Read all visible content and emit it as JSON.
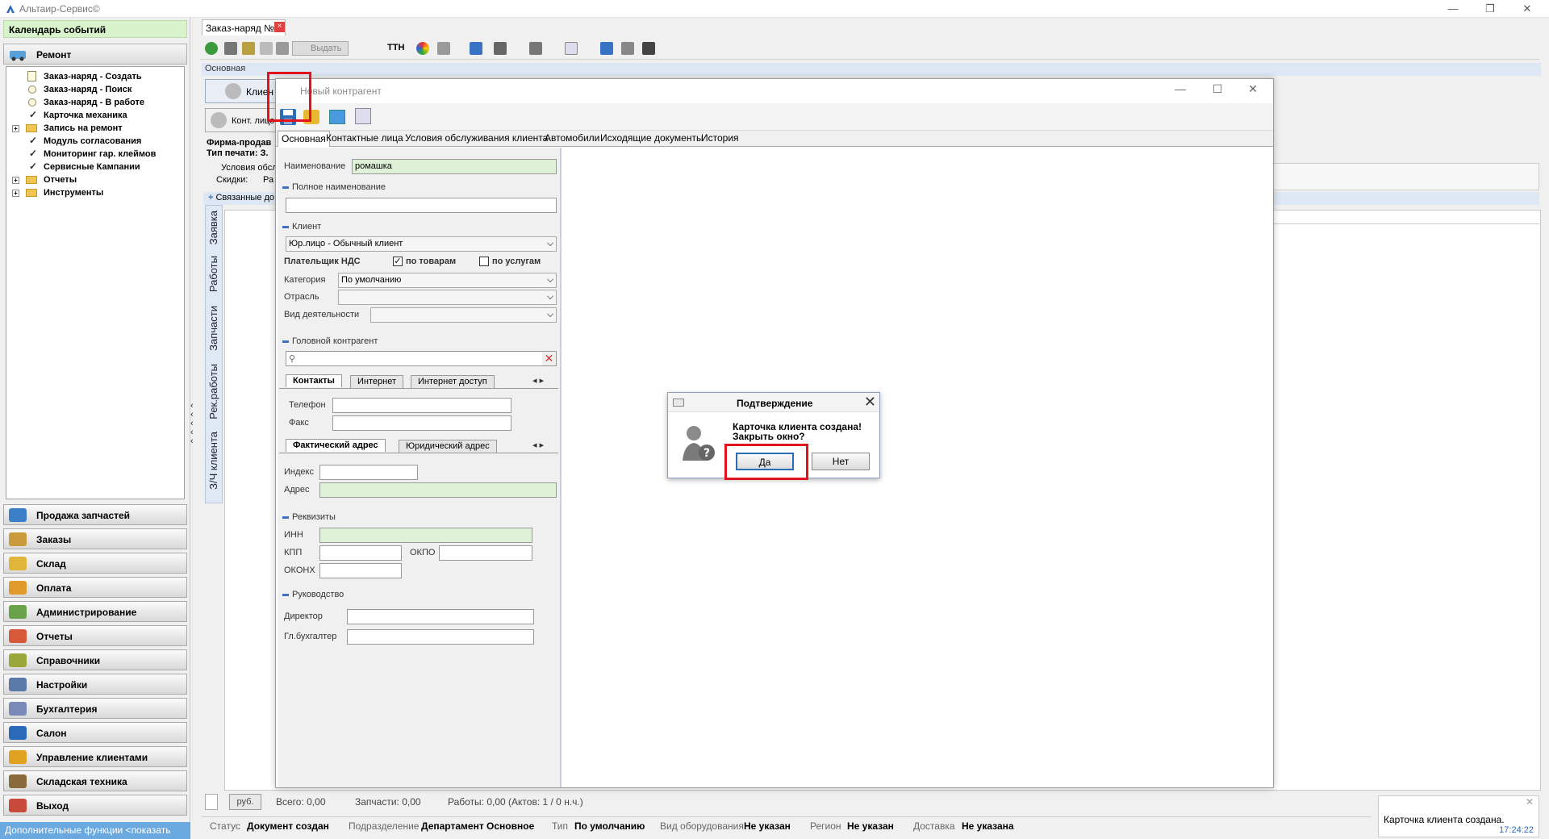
{
  "app": {
    "title": "Альтаир-Сервис©"
  },
  "left": {
    "calendar": "Календарь событий",
    "section": "Ремонт",
    "tree": [
      {
        "label": "Заказ-наряд - Создать",
        "kind": "doc"
      },
      {
        "label": "Заказ-наряд - Поиск",
        "kind": "circle"
      },
      {
        "label": "Заказ-наряд - В работе",
        "kind": "circle"
      },
      {
        "label": "Карточка механика",
        "kind": "check"
      },
      {
        "label": "Запись на ремонт",
        "kind": "folder"
      },
      {
        "label": "Модуль согласования",
        "kind": "check"
      },
      {
        "label": "Мониторинг гар. клеймов",
        "kind": "check"
      },
      {
        "label": "Сервисные Кампании",
        "kind": "check"
      },
      {
        "label": "Отчеты",
        "kind": "folder"
      },
      {
        "label": "Инструменты",
        "kind": "folder"
      }
    ],
    "nav": [
      {
        "label": "Продажа запчастей",
        "color": "#3a7fc8"
      },
      {
        "label": "Заказы",
        "color": "#c99b3a"
      },
      {
        "label": "Склад",
        "color": "#e1b53a"
      },
      {
        "label": "Оплата",
        "color": "#e09a2a"
      },
      {
        "label": "Администрирование",
        "color": "#6aa24a"
      },
      {
        "label": "Отчеты",
        "color": "#d65a3a"
      },
      {
        "label": "Справочники",
        "color": "#9aa83a"
      },
      {
        "label": "Настройки",
        "color": "#5a7aa8"
      },
      {
        "label": "Бухгалтерия",
        "color": "#7a8ab8"
      },
      {
        "label": "Салон",
        "color": "#2a6ab8"
      },
      {
        "label": "Управление клиентами",
        "color": "#e0a020"
      },
      {
        "label": "Складская техника",
        "color": "#8a6a3a"
      },
      {
        "label": "Выход",
        "color": "#c84a3a"
      }
    ],
    "more": "Дополнительные функции <показать"
  },
  "doc_tab": {
    "label": "Заказ-наряд №5",
    "close": "×"
  },
  "toolbar": {
    "vydat": "Выдать",
    "ttn": "ТТН"
  },
  "main": {
    "section": "Основная",
    "client_btn": "Клиен",
    "contact_btn": "Конт. лицо",
    "firma": "Фирма-продав",
    "tip_pechati": "Тип печати: З.",
    "usloviya": "Условия обсл",
    "skidki": "Скидки:",
    "skidki_val": "Ра",
    "related": "Связанные до",
    "vtabs": [
      "Заявка",
      "Работы",
      "Запчасти",
      "Рек.работы",
      "З/Ч клиента"
    ]
  },
  "dialog": {
    "title": "Новый контрагент",
    "tabs": [
      "Основная",
      "Контактные лица",
      "Условия обслуживания клиента",
      "Автомобили",
      "Исходящие документы",
      "История"
    ],
    "name_label": "Наименование",
    "name_value": "ромашка",
    "full_name_group": "Полное наименование",
    "client_group": "Клиент",
    "client_type": "Юр.лицо - Обычный клиент",
    "nds_label": "Плательщик НДС",
    "nds_goods": "по товарам",
    "nds_services": "по услугам",
    "nds_goods_checked": "✓",
    "category_label": "Категория",
    "category_value": "По умолчанию",
    "industry_label": "Отрасль",
    "activity_label": "Вид деятельности",
    "head_group": "Головной контрагент",
    "contacts_tabs": [
      "Контакты",
      "Интернет",
      "Интернет доступ"
    ],
    "phone_label": "Телефон",
    "fax_label": "Факс",
    "address_tabs": [
      "Фактический адрес",
      "Юридический адрес"
    ],
    "index_label": "Индекс",
    "address_label": "Адрес",
    "req_group": "Реквизиты",
    "inn_label": "ИНН",
    "kpp_label": "КПП",
    "okpo_label": "ОКПО",
    "okonh_label": "ОКОНХ",
    "mgmt_group": "Руководство",
    "director_label": "Директор",
    "accountant_label": "Гл.бухгалтер"
  },
  "confirm": {
    "title": "Подтверждение",
    "line1": "Карточка клиента создана!",
    "line2": "Закрыть окно?",
    "yes": "Да",
    "no": "Нет"
  },
  "summary": {
    "currency": "руб.",
    "total": "Всего: 0,00",
    "parts": "Запчасти: 0,00",
    "works": "Работы: 0,00 (Актов: 1 / 0 н.ч.)"
  },
  "status": {
    "status_label": "Статус",
    "status_value": "Документ создан",
    "dept_label": "Подразделение",
    "dept_value": "Департамент Основное",
    "type_label": "Тип",
    "type_value": "По умолчанию",
    "equip_label": "Вид оборудования",
    "equip_value": "Не указан",
    "region_label": "Регион",
    "region_value": "Не указан",
    "delivery_label": "Доставка",
    "delivery_value": "Не указана"
  },
  "notification": {
    "text": "Карточка клиента создана.",
    "time": "17:24:22"
  },
  "colors": {
    "accent": "#3a73c3",
    "highlight": "#e0121c",
    "green_field": "#dff2d8"
  }
}
